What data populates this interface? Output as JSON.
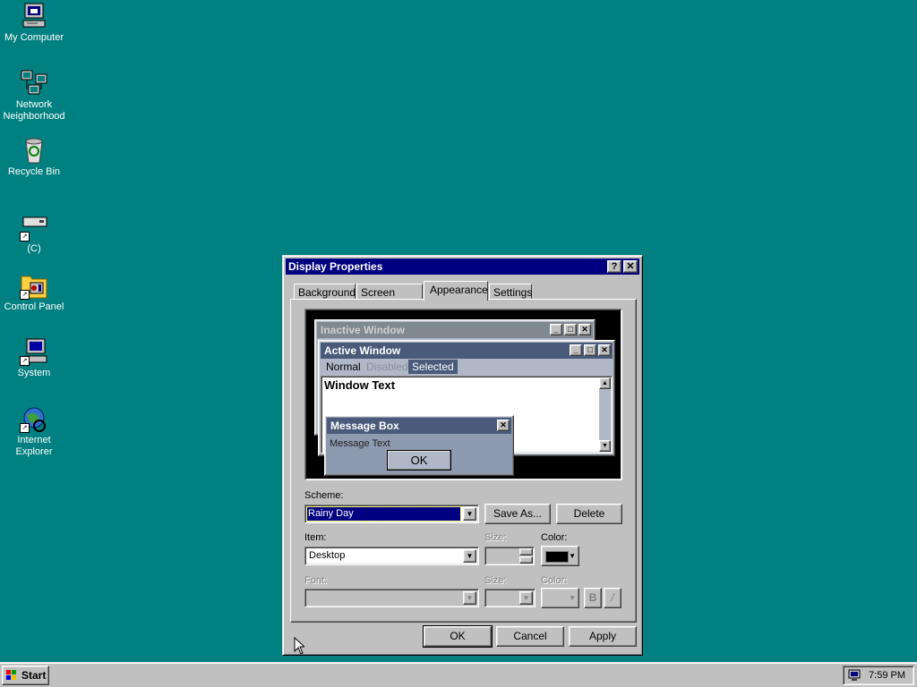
{
  "desktop_icons": [
    {
      "label": "My Computer",
      "icon": "computer-icon"
    },
    {
      "label": "Network\nNeighborhood",
      "icon": "network-icon"
    },
    {
      "label": "Recycle Bin",
      "icon": "recycle-bin-icon"
    },
    {
      "label": "(C)",
      "icon": "drive-shortcut-icon"
    },
    {
      "label": "Control Panel",
      "icon": "control-panel-icon"
    },
    {
      "label": "System",
      "icon": "system-icon"
    },
    {
      "label": "Internet\nExplorer",
      "icon": "internet-explorer-icon"
    }
  ],
  "dialog": {
    "title": "Display Properties",
    "help_glyph": "?",
    "close_glyph": "✕",
    "tabs": [
      "Background",
      "Screen Saver",
      "Appearance",
      "Settings"
    ],
    "active_tab": "Appearance",
    "preview": {
      "inactive_title": "Inactive Window",
      "active_title": "Active Window",
      "menu": {
        "normal": "Normal",
        "disabled": "Disabled",
        "selected": "Selected"
      },
      "window_text": "Window Text",
      "msgbox_title": "Message Box",
      "msgbox_text": "Message Text",
      "msgbox_ok": "OK"
    },
    "scheme_label": "Scheme:",
    "scheme_value": "Rainy Day",
    "save_as_label": "Save As...",
    "delete_label": "Delete",
    "item_label": "Item:",
    "item_value": "Desktop",
    "size_label": "Size:",
    "color_label": "Color:",
    "item_color": "#000000",
    "font_label": "Font:",
    "font_size_label": "Size:",
    "font_color_label": "Color:",
    "bold_label": "B",
    "italic_label": "/",
    "ok_label": "OK",
    "cancel_label": "Cancel",
    "apply_label": "Apply"
  },
  "taskbar": {
    "start_label": "Start",
    "clock": "7:59 PM"
  },
  "colors": {
    "desktop": "#008080",
    "title_active": "#000080",
    "rainy_active_title": "#4a5a7a",
    "rainy_inactive_title": "#808890",
    "rainy_window_bg": "#b0b8c8"
  }
}
